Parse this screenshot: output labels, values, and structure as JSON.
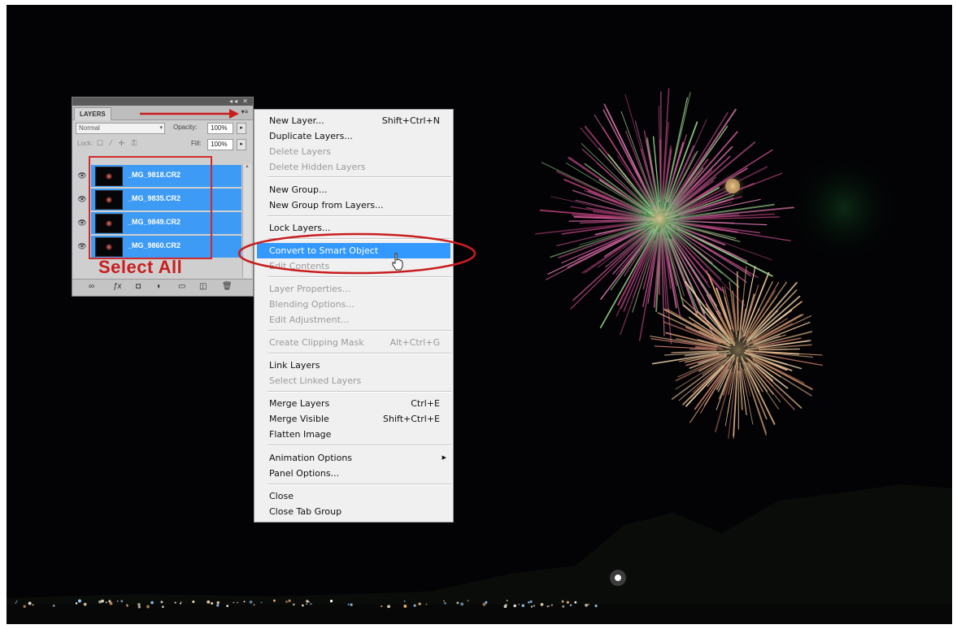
{
  "layers_panel": {
    "tab": "LAYERS",
    "blend_mode": "Normal",
    "opacity_label": "Opacity:",
    "opacity_value": "100%",
    "lock_label": "Lock:",
    "fill_label": "Fill:",
    "fill_value": "100%",
    "layers": [
      {
        "name": "_MG_9818.CR2"
      },
      {
        "name": "_MG_9835.CR2"
      },
      {
        "name": "_MG_9849.CR2"
      },
      {
        "name": "_MG_9860.CR2"
      }
    ]
  },
  "annotation": {
    "select_all": "Select All",
    "accent_color": "#c81e1e"
  },
  "context_menu": {
    "items": [
      {
        "label": "New Layer...",
        "shortcut": "Shift+Ctrl+N",
        "disabled": false
      },
      {
        "label": "Duplicate Layers...",
        "shortcut": "",
        "disabled": false
      },
      {
        "label": "Delete Layers",
        "shortcut": "",
        "disabled": true
      },
      {
        "label": "Delete Hidden Layers",
        "shortcut": "",
        "disabled": true
      },
      {
        "label": "New Group...",
        "shortcut": "",
        "disabled": false
      },
      {
        "label": "New Group from Layers...",
        "shortcut": "",
        "disabled": false
      },
      {
        "label": "Lock Layers...",
        "shortcut": "",
        "disabled": false
      },
      {
        "label": "Convert to Smart Object",
        "shortcut": "",
        "disabled": false,
        "highlighted": true
      },
      {
        "label": "Edit Contents",
        "shortcut": "",
        "disabled": true
      },
      {
        "label": "Layer Properties...",
        "shortcut": "",
        "disabled": true
      },
      {
        "label": "Blending Options...",
        "shortcut": "",
        "disabled": true
      },
      {
        "label": "Edit Adjustment...",
        "shortcut": "",
        "disabled": true
      },
      {
        "label": "Create Clipping Mask",
        "shortcut": "Alt+Ctrl+G",
        "disabled": true
      },
      {
        "label": "Link Layers",
        "shortcut": "",
        "disabled": false
      },
      {
        "label": "Select Linked Layers",
        "shortcut": "",
        "disabled": true
      },
      {
        "label": "Merge Layers",
        "shortcut": "Ctrl+E",
        "disabled": false
      },
      {
        "label": "Merge Visible",
        "shortcut": "Shift+Ctrl+E",
        "disabled": false
      },
      {
        "label": "Flatten Image",
        "shortcut": "",
        "disabled": false
      },
      {
        "label": "Animation Options",
        "shortcut": "",
        "disabled": false,
        "submenu": true
      },
      {
        "label": "Panel Options...",
        "shortcut": "",
        "disabled": false
      },
      {
        "label": "Close",
        "shortcut": "",
        "disabled": false
      },
      {
        "label": "Close Tab Group",
        "shortcut": "",
        "disabled": false
      }
    ],
    "highlight_color": "#3399ff"
  }
}
